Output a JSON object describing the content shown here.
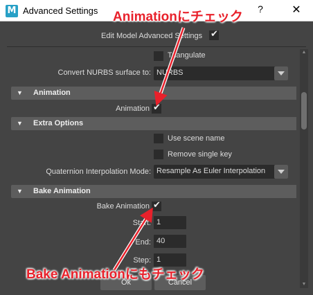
{
  "window": {
    "title": "Advanced Settings",
    "app_icon_letter": "M",
    "help_glyph": "?",
    "close_glyph": "✕"
  },
  "header": {
    "label": "Edit Model Advanced Settings",
    "checked": true
  },
  "rows": {
    "triangulate_label": "Triangulate",
    "convert_nurbs_label": "Convert NURBS surface to:",
    "convert_nurbs_value": "NURBS"
  },
  "sections": {
    "animation": {
      "title": "Animation",
      "animation_label": "Animation"
    },
    "extra_options": {
      "title": "Extra Options",
      "use_scene_name_label": "Use scene name",
      "remove_single_key_label": "Remove single key",
      "quaternion_label": "Quaternion Interpolation Mode:",
      "quaternion_value": "Resample As Euler Interpolation"
    },
    "bake_animation": {
      "title": "Bake Animation",
      "bake_label": "Bake Animation",
      "start_label": "Start:",
      "start_value": "1",
      "end_label": "End:",
      "end_value": "40",
      "step_label": "Step:",
      "step_value": "1"
    }
  },
  "buttons": {
    "ok": "Ok",
    "cancel": "Cancel"
  },
  "annotations": {
    "top": "Animationにチェック",
    "bottom": "Bake Animationにもチェック",
    "color": "#e8212b"
  }
}
